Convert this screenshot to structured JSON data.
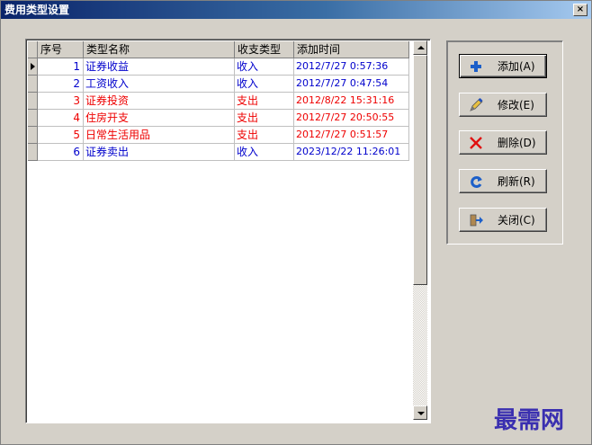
{
  "window": {
    "title": "费用类型设置",
    "close_label": "×"
  },
  "grid": {
    "headers": [
      "序号",
      "类型名称",
      "收支类型",
      "添加时间"
    ],
    "rows": [
      {
        "no": "1",
        "name": "证券收益",
        "type": "收入",
        "time": "2012/7/27 0:57:36",
        "color": "blue"
      },
      {
        "no": "2",
        "name": "工资收入",
        "type": "收入",
        "time": "2012/7/27 0:47:54",
        "color": "blue"
      },
      {
        "no": "3",
        "name": "证券投资",
        "type": "支出",
        "time": "2012/8/22 15:31:16",
        "color": "red"
      },
      {
        "no": "4",
        "name": "住房开支",
        "type": "支出",
        "time": "2012/7/27 20:50:55",
        "color": "red"
      },
      {
        "no": "5",
        "name": "日常生活用品",
        "type": "支出",
        "time": "2012/7/27 0:51:57",
        "color": "red"
      },
      {
        "no": "6",
        "name": "证券卖出",
        "type": "收入",
        "time": "2023/12/22 11:26:01",
        "color": "blue"
      }
    ]
  },
  "buttons": {
    "add": "添加(A)",
    "edit": "修改(E)",
    "delete": "删除(D)",
    "refresh": "刷新(R)",
    "close": "关闭(C)"
  },
  "icons": {
    "add": "plus-icon",
    "edit": "pencil-icon",
    "delete": "x-icon",
    "refresh": "refresh-icon",
    "close": "door-exit-icon"
  },
  "colors": {
    "blue": "#0000cc",
    "red": "#ee0000",
    "title_bar": "#0a246a"
  },
  "watermark": "最需网"
}
